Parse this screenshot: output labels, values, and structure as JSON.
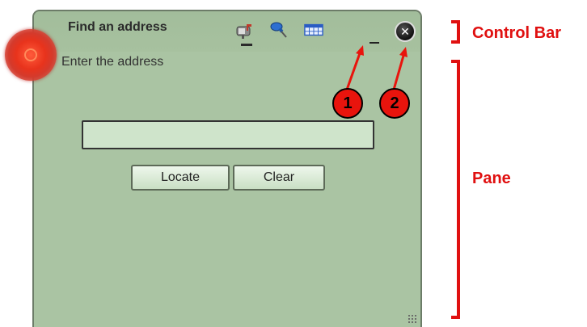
{
  "widget": {
    "title": "Find an address",
    "tools": [
      "mailbox-icon",
      "pushpin-icon",
      "table-icon"
    ],
    "minimize_icon": "minimize-icon",
    "close_icon": "close-icon",
    "instruction": "Enter the address",
    "address_input": {
      "value": "",
      "placeholder": ""
    },
    "buttons": {
      "locate": "Locate",
      "clear": "Clear"
    }
  },
  "callouts": {
    "one": "1",
    "two": "2"
  },
  "annotations": {
    "control_bar": "Control Bar",
    "pane": "Pane"
  },
  "colors": {
    "panel": "#aac4a3",
    "annotation": "#e01010",
    "callout": "#e8140d"
  }
}
